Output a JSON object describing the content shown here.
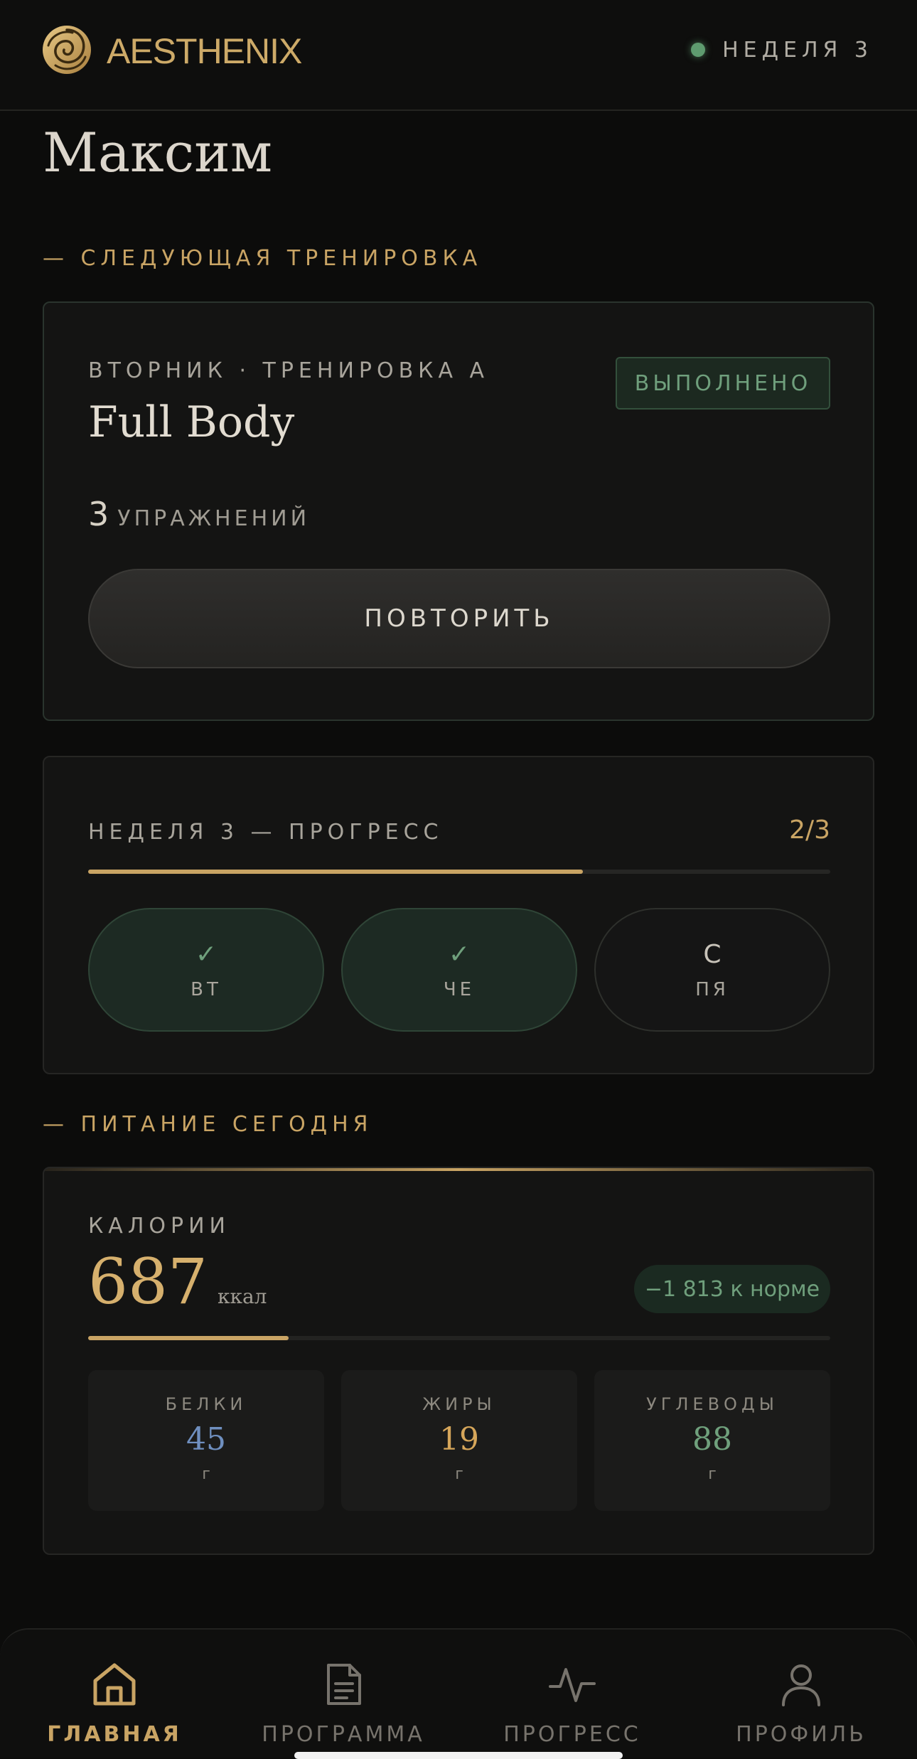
{
  "header": {
    "brand": "AESTHENIX",
    "week_badge": "НЕДЕЛЯ 3",
    "status_color": "#5e9b6f",
    "accent_color": "#c9a464"
  },
  "user": {
    "name": "Максим"
  },
  "next_workout": {
    "section_title": "— СЛЕДУЮЩАЯ ТРЕНИРОВКА",
    "day_label": "ВТОРНИК · ТРЕНИРОВКА А",
    "title": "Full Body",
    "status_badge": "ВЫПОЛНЕНО",
    "exercise_count": "3",
    "exercise_label": "УПРАЖНЕНИЙ",
    "repeat_button": "ПОВТОРИТЬ"
  },
  "week_progress": {
    "title": "НЕДЕЛЯ 3 — ПРОГРЕСС",
    "count": "2/3",
    "fraction": 0.667,
    "days": [
      {
        "mark": "✓",
        "name": "ВТ",
        "state": "done"
      },
      {
        "mark": "✓",
        "name": "ЧЕ",
        "state": "done"
      },
      {
        "mark": "С",
        "name": "ПЯ",
        "state": "pending"
      }
    ]
  },
  "nutrition": {
    "section_title": "— ПИТАНИЕ СЕГОДНЯ",
    "calories_label": "КАЛОРИИ",
    "calories_value": "687",
    "calories_unit": "ккал",
    "norm_badge": "−1 813 к норме",
    "calories_fraction": 0.27,
    "macros": [
      {
        "name": "БЕЛКИ",
        "value": "45",
        "unit": "г",
        "color": "#6f8fbf"
      },
      {
        "name": "ЖИРЫ",
        "value": "19",
        "unit": "г",
        "color": "#d6a65a"
      },
      {
        "name": "УГЛЕВОДЫ",
        "value": "88",
        "unit": "г",
        "color": "#6fa07c"
      }
    ]
  },
  "nav": {
    "items": [
      {
        "label": "ГЛАВНАЯ",
        "icon": "home-icon",
        "active": true
      },
      {
        "label": "ПРОГРАММА",
        "icon": "document-icon",
        "active": false
      },
      {
        "label": "ПРОГРЕСС",
        "icon": "activity-icon",
        "active": false
      },
      {
        "label": "ПРОФИЛЬ",
        "icon": "user-icon",
        "active": false
      }
    ]
  }
}
